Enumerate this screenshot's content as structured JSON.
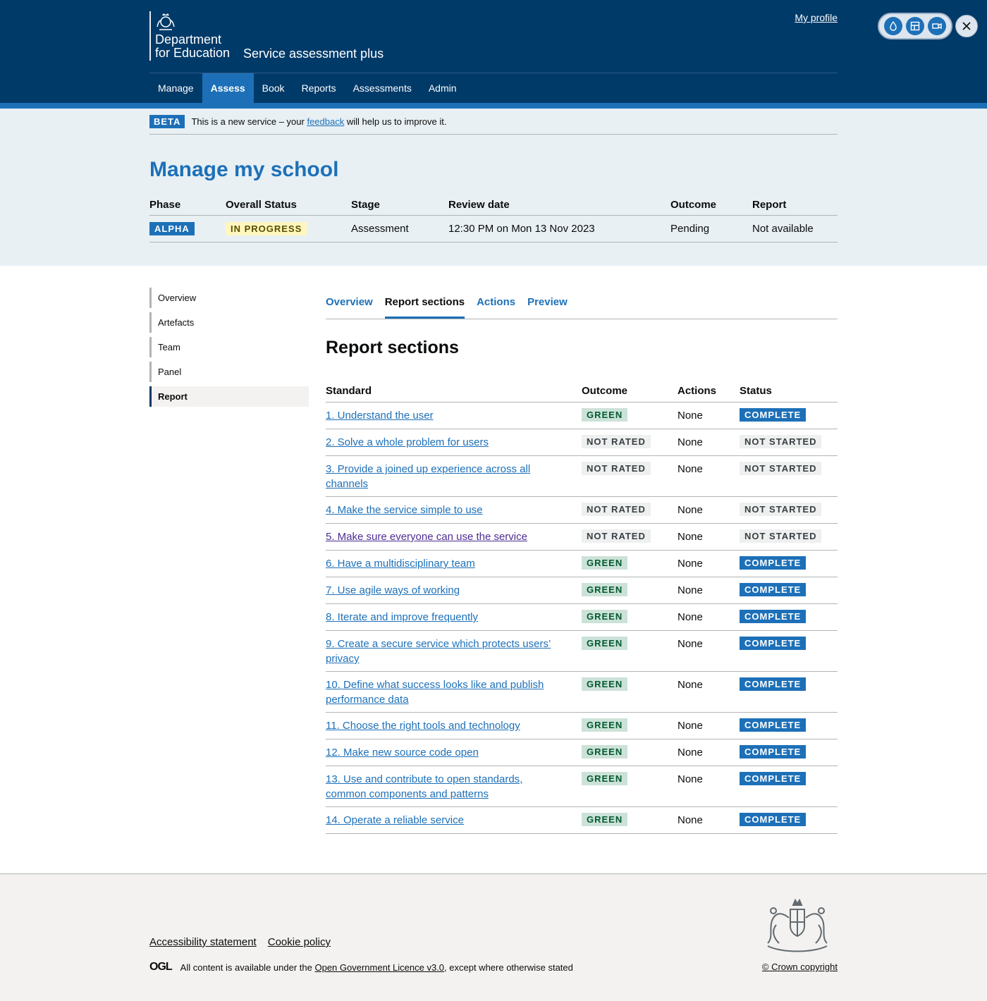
{
  "header": {
    "department_line1": "Department",
    "department_line2": "for Education",
    "service_name": "Service assessment plus",
    "my_profile": "My profile",
    "nav": [
      "Manage",
      "Assess",
      "Book",
      "Reports",
      "Assessments",
      "Admin"
    ],
    "active_nav": "Assess"
  },
  "beta": {
    "tag": "BETA",
    "text_before": "This is a new service – your",
    "link": "feedback",
    "text_after": "will help us to improve it."
  },
  "summary": {
    "title": "Manage my school",
    "headers": [
      "Phase",
      "Overall Status",
      "Stage",
      "Review date",
      "Outcome",
      "Report"
    ],
    "phase": "ALPHA",
    "overall_status": "IN PROGRESS",
    "stage": "Assessment",
    "review_date": "12:30 PM on Mon 13 Nov 2023",
    "outcome": "Pending",
    "report": "Not available"
  },
  "side_nav": [
    "Overview",
    "Artefacts",
    "Team",
    "Panel",
    "Report"
  ],
  "side_nav_active": "Report",
  "tabs": [
    "Overview",
    "Report sections",
    "Actions",
    "Preview"
  ],
  "active_tab": "Report sections",
  "section_title": "Report sections",
  "table": {
    "headers": [
      "Standard",
      "Outcome",
      "Actions",
      "Status"
    ],
    "rows": [
      {
        "standard": "1. Understand the user",
        "outcome": "GREEN",
        "actions": "None",
        "status": "COMPLETE"
      },
      {
        "standard": "2. Solve a whole problem for users",
        "outcome": "NOT RATED",
        "actions": "None",
        "status": "NOT STARTED"
      },
      {
        "standard": "3. Provide a joined up experience across all channels",
        "outcome": "NOT RATED",
        "actions": "None",
        "status": "NOT STARTED"
      },
      {
        "standard": "4. Make the service simple to use",
        "outcome": "NOT RATED",
        "actions": "None",
        "status": "NOT STARTED"
      },
      {
        "standard": "5. Make sure everyone can use the service",
        "outcome": "NOT RATED",
        "actions": "None",
        "status": "NOT STARTED"
      },
      {
        "standard": "6. Have a multidisciplinary team",
        "outcome": "GREEN",
        "actions": "None",
        "status": "COMPLETE"
      },
      {
        "standard": "7. Use agile ways of working",
        "outcome": "GREEN",
        "actions": "None",
        "status": "COMPLETE"
      },
      {
        "standard": "8. Iterate and improve frequently",
        "outcome": "GREEN",
        "actions": "None",
        "status": "COMPLETE"
      },
      {
        "standard": "9. Create a secure service which protects users’ privacy",
        "outcome": "GREEN",
        "actions": "None",
        "status": "COMPLETE"
      },
      {
        "standard": "10. Define what success looks like and publish performance data",
        "outcome": "GREEN",
        "actions": "None",
        "status": "COMPLETE"
      },
      {
        "standard": "11. Choose the right tools and technology",
        "outcome": "GREEN",
        "actions": "None",
        "status": "COMPLETE"
      },
      {
        "standard": "12. Make new source code open",
        "outcome": "GREEN",
        "actions": "None",
        "status": "COMPLETE"
      },
      {
        "standard": "13. Use and contribute to open standards, common components and patterns",
        "outcome": "GREEN",
        "actions": "None",
        "status": "COMPLETE"
      },
      {
        "standard": "14. Operate a reliable service",
        "outcome": "GREEN",
        "actions": "None",
        "status": "COMPLETE"
      }
    ]
  },
  "footer": {
    "links": [
      "Accessibility statement",
      "Cookie policy"
    ],
    "ogl": "OGL",
    "licence_before": "All content is available under the",
    "licence_link": "Open Government Licence v3.0",
    "licence_after": ", except where otherwise stated",
    "copyright": "© Crown copyright"
  },
  "colors": {
    "header_bg": "#003a69",
    "brand_blue": "#1d70b8",
    "summary_bg": "#e8f0f4",
    "footer_bg": "#f3f2f1"
  }
}
